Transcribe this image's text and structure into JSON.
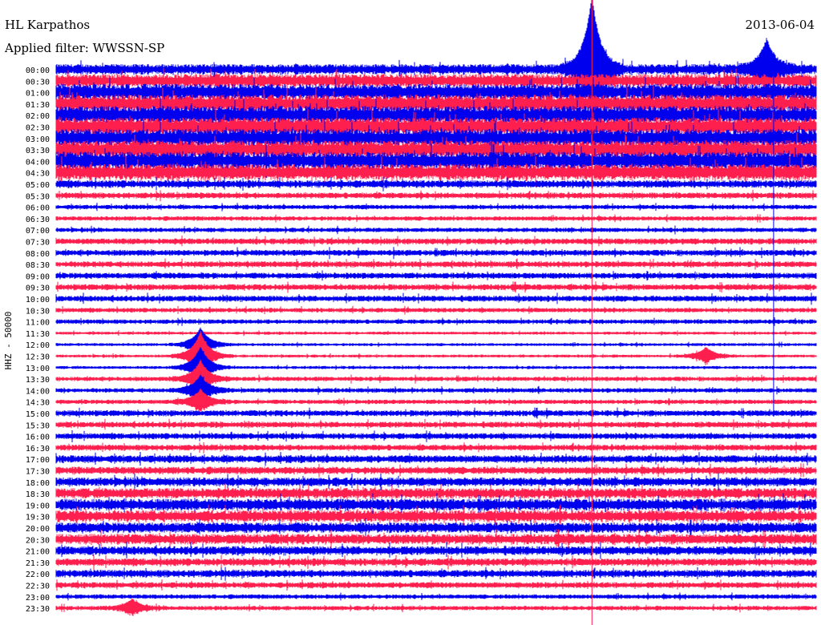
{
  "header": {
    "station": "HL Karpathos",
    "date": "2013-06-04",
    "filter": "Applied filter: WWSSN-SP"
  },
  "chart_data": {
    "type": "line",
    "title": "HL Karpathos",
    "subtitle": "Applied filter: WWSSN-SP",
    "ylabel": "HHZ - 50000",
    "row_labels": [
      "00:00",
      "00:30",
      "01:00",
      "01:30",
      "02:00",
      "02:30",
      "03:00",
      "03:30",
      "04:00",
      "04:30",
      "05:00",
      "05:30",
      "06:00",
      "06:30",
      "07:00",
      "07:30",
      "08:00",
      "08:30",
      "09:00",
      "09:30",
      "10:00",
      "10:30",
      "11:00",
      "11:30",
      "12:00",
      "12:30",
      "13:00",
      "13:30",
      "14:00",
      "14:30",
      "15:00",
      "15:30",
      "16:00",
      "16:30",
      "17:00",
      "17:30",
      "18:00",
      "18:30",
      "19:00",
      "19:30",
      "20:00",
      "20:30",
      "21:00",
      "21:30",
      "22:00",
      "22:30",
      "23:00",
      "23:30"
    ],
    "series_colors": [
      "#0000ee",
      "#ff1f4f"
    ],
    "trace_amplitude": [
      7,
      9,
      11,
      12,
      12,
      12,
      12,
      12,
      12,
      11,
      5,
      4,
      3,
      3,
      3,
      4,
      4,
      4,
      4,
      4,
      4,
      3,
      3,
      2,
      2,
      2,
      2,
      3,
      3,
      3,
      4,
      4,
      4,
      4,
      5,
      5,
      6,
      7,
      8,
      8,
      7,
      7,
      6,
      5,
      5,
      4,
      3,
      3
    ],
    "events": [
      {
        "row": 0,
        "x_frac": 0.705,
        "amp": 90
      },
      {
        "row": 0,
        "x_frac": 0.935,
        "amp": 35
      },
      {
        "row": 24,
        "x_frac": 0.19,
        "amp": 20
      },
      {
        "row": 25,
        "x_frac": 0.19,
        "amp": 30
      },
      {
        "row": 25,
        "x_frac": 0.855,
        "amp": 10
      },
      {
        "row": 26,
        "x_frac": 0.19,
        "amp": 25
      },
      {
        "row": 27,
        "x_frac": 0.19,
        "amp": 22
      },
      {
        "row": 28,
        "x_frac": 0.19,
        "amp": 18
      },
      {
        "row": 29,
        "x_frac": 0.19,
        "amp": 14
      },
      {
        "row": 47,
        "x_frac": 0.1,
        "amp": 10
      }
    ]
  }
}
